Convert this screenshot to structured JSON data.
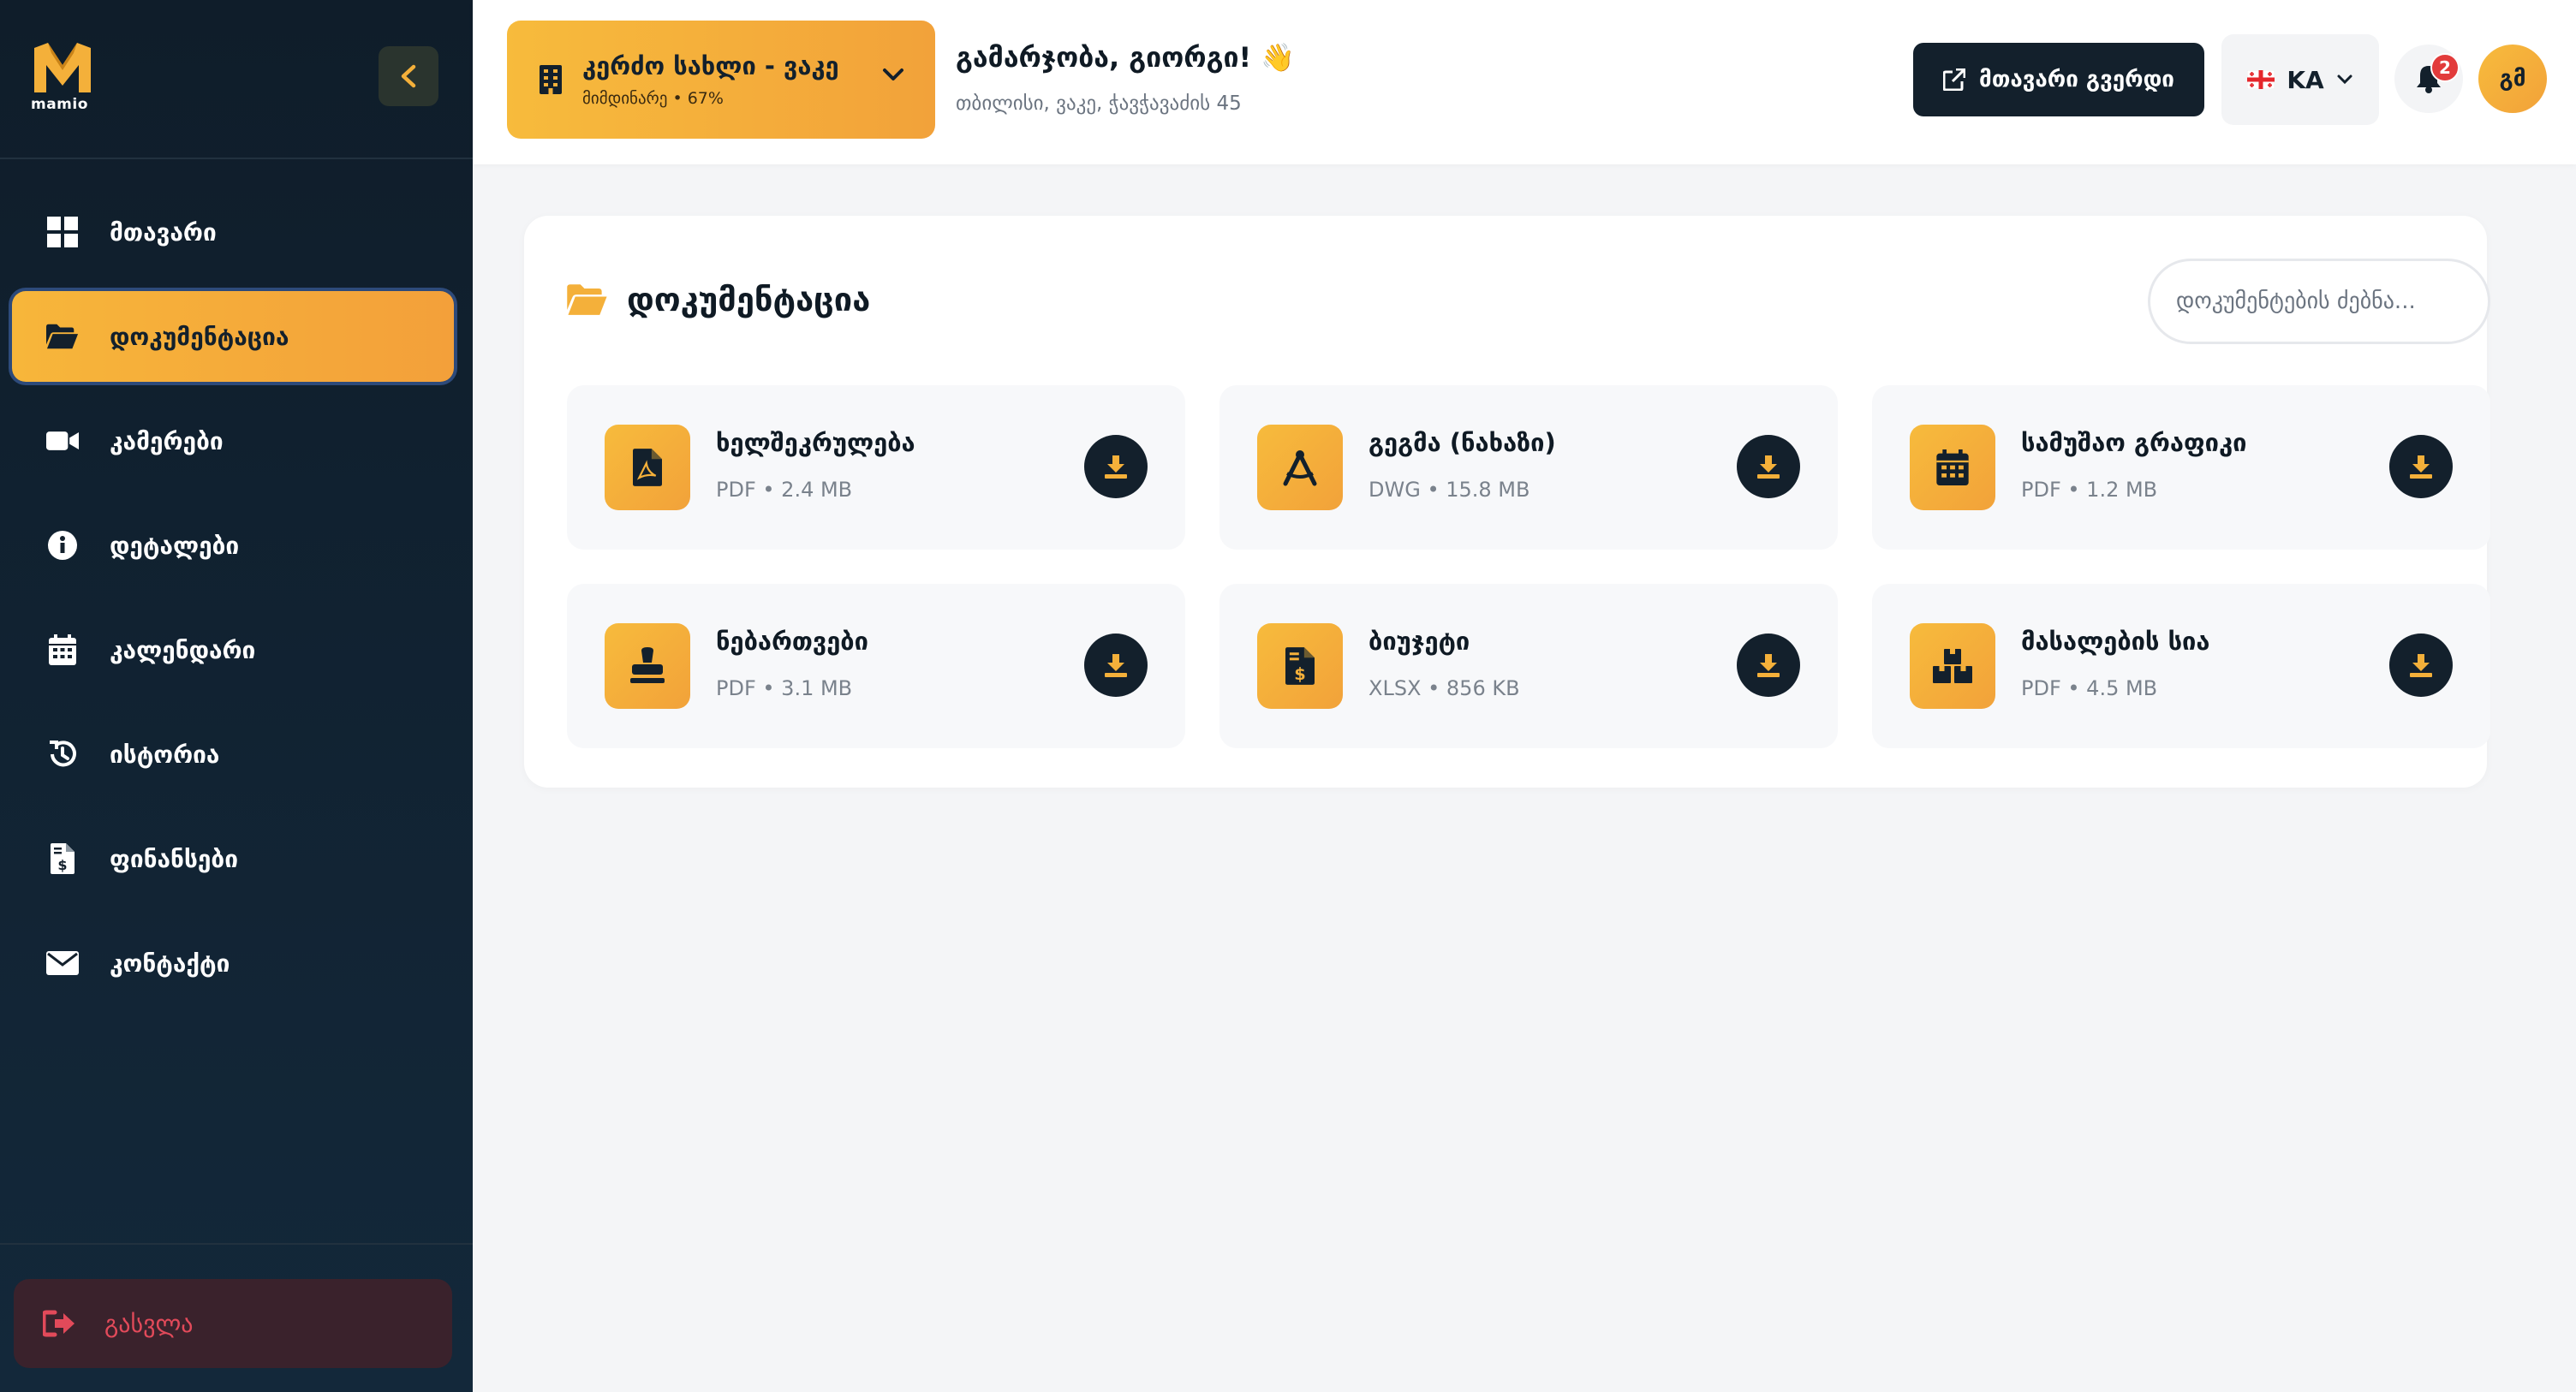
{
  "brand": {
    "name": "mamio",
    "accent": "#f4a93a",
    "dark": "#13202c"
  },
  "sidebar": {
    "collapse_icon": "chevron-left-icon",
    "items": [
      {
        "id": "home",
        "label": "მთავარი",
        "icon": "grid-icon",
        "active": false
      },
      {
        "id": "documents",
        "label": "დოკუმენტაცია",
        "icon": "folder-open-icon",
        "active": true
      },
      {
        "id": "cameras",
        "label": "კამერები",
        "icon": "video-icon",
        "active": false
      },
      {
        "id": "details",
        "label": "დეტალები",
        "icon": "info-icon",
        "active": false
      },
      {
        "id": "calendar",
        "label": "კალენდარი",
        "icon": "calendar-icon",
        "active": false
      },
      {
        "id": "history",
        "label": "ისტორია",
        "icon": "history-icon",
        "active": false
      },
      {
        "id": "finance",
        "label": "ფინანსები",
        "icon": "invoice-dollar-icon",
        "active": false
      },
      {
        "id": "contact",
        "label": "კონტაქტი",
        "icon": "envelope-icon",
        "active": false
      }
    ],
    "logout_label": "გასვლა"
  },
  "header": {
    "project": {
      "name": "კერძო სახლი - ვაკე",
      "status": "მიმდინარე • 67%"
    },
    "greeting": "გამარჯობა, გიორგი! 👋",
    "address": "თბილისი, ვაკე, ჭავჭავაძის 45",
    "main_page_label": "მთავარი გვერდი",
    "language": "KA",
    "notifications_count": "2",
    "avatar_initials": "გმ"
  },
  "documents": {
    "title": "დოკუმენტაცია",
    "search_placeholder": "დოკუმენტების ძებნა...",
    "items": [
      {
        "name": "ხელშეკრულება",
        "meta": "PDF • 2.4 MB",
        "icon": "file-pdf-icon"
      },
      {
        "name": "გეგმა (ნახაზი)",
        "meta": "DWG • 15.8 MB",
        "icon": "compass-drafting-icon"
      },
      {
        "name": "სამუშაო გრაფიკი",
        "meta": "PDF • 1.2 MB",
        "icon": "calendar-icon"
      },
      {
        "name": "ნებართვები",
        "meta": "PDF • 3.1 MB",
        "icon": "stamp-icon"
      },
      {
        "name": "ბიუჯეტი",
        "meta": "XLSX • 856 KB",
        "icon": "invoice-dollar-icon"
      },
      {
        "name": "მასალების სია",
        "meta": "PDF • 4.5 MB",
        "icon": "boxes-icon"
      }
    ]
  }
}
